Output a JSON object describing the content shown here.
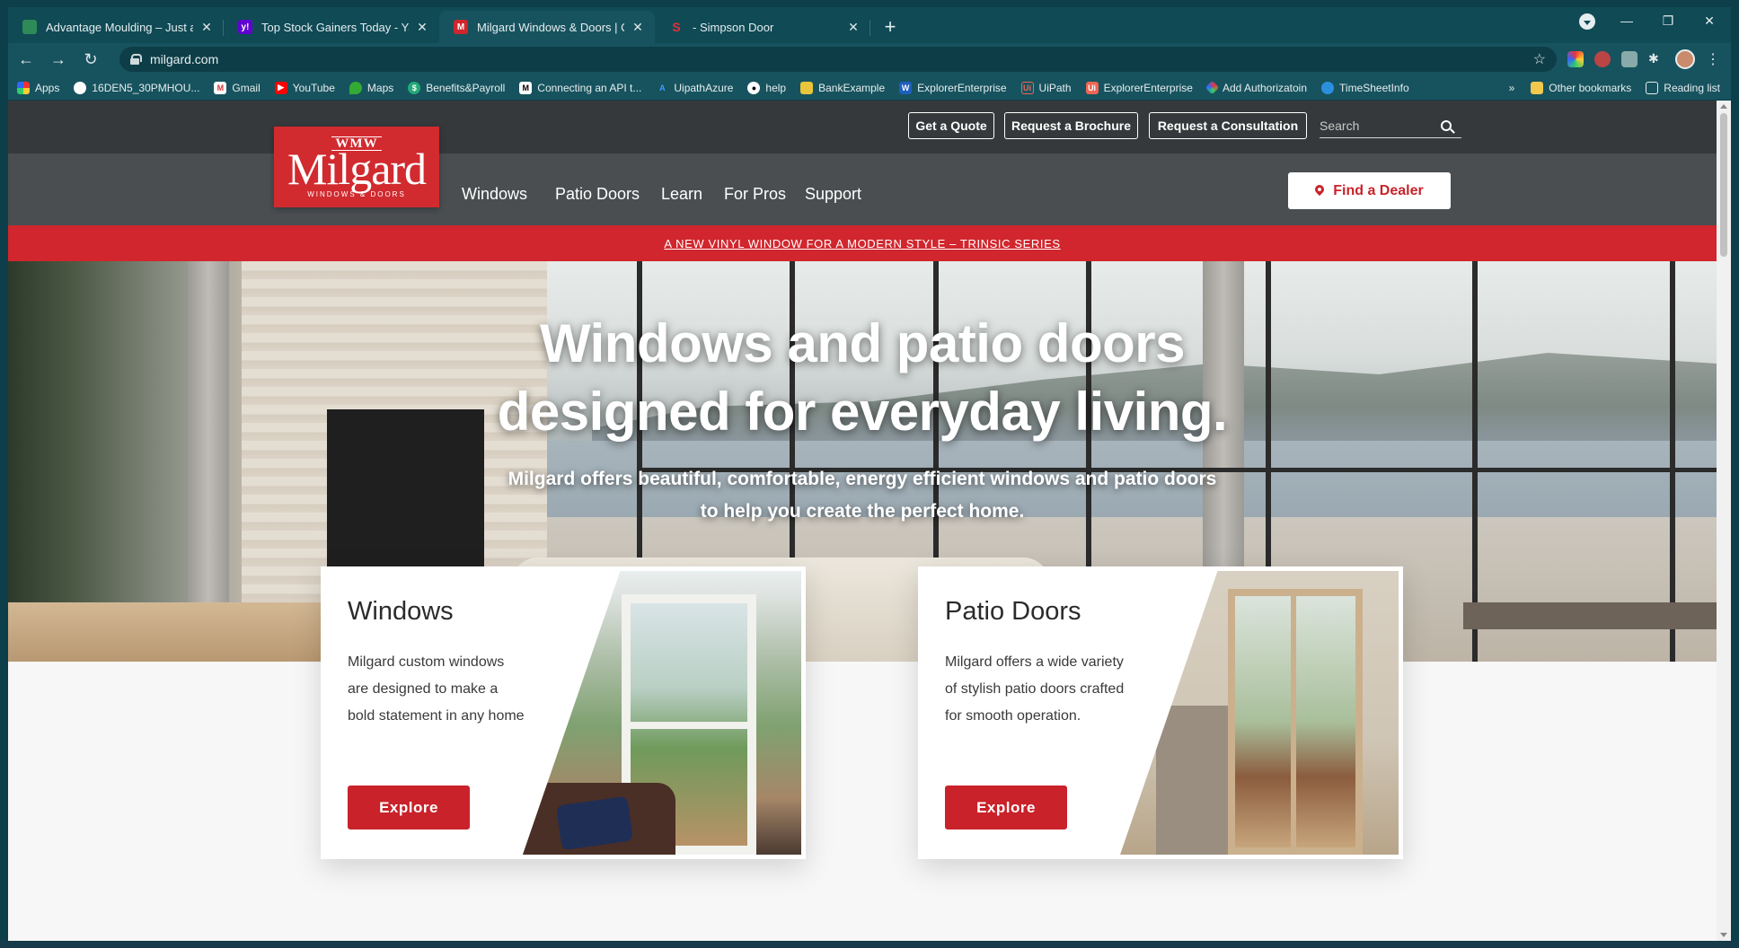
{
  "browser": {
    "tabs": [
      {
        "title": "Advantage Moulding – Just anoth",
        "active": false
      },
      {
        "title": "Top Stock Gainers Today - Yahoo",
        "active": false
      },
      {
        "title": "Milgard Windows & Doors | Cust",
        "active": true
      },
      {
        "title": "- Simpson Door",
        "active": false
      }
    ],
    "new_tab": "+",
    "url": "milgard.com",
    "bookmarks": [
      "Apps",
      "16DEN5_30PMHOU...",
      "Gmail",
      "YouTube",
      "Maps",
      "Benefits&Payroll",
      "Connecting an API t...",
      "UipathAzure",
      "help",
      "BankExample",
      "ExplorerEnterprise",
      "UiPath",
      "ExplorerEnterprise",
      "Add Authorizatoin",
      "TimeSheetInfo"
    ],
    "bookmarks_overflow": "»",
    "other_bookmarks": "Other bookmarks",
    "reading_list": "Reading list"
  },
  "site": {
    "utility": {
      "quote": "Get a Quote",
      "brochure": "Request a Brochure",
      "consultation": "Request a Consultation",
      "search_placeholder": "Search"
    },
    "logo": {
      "mark": "WMW",
      "word": "Milgard",
      "sub": "WINDOWS & DOORS"
    },
    "nav": [
      "Windows",
      "Patio Doors",
      "Learn",
      "For Pros",
      "Support"
    ],
    "dealer": "Find a Dealer",
    "promo": "A NEW VINYL WINDOW FOR A MODERN STYLE – TRINSIC SERIES",
    "hero": {
      "line1": "Windows and patio doors",
      "line2": "designed for everyday living.",
      "sub1": "Milgard offers beautiful, comfortable, energy efficient windows and patio doors",
      "sub2": "to help you create the perfect home."
    },
    "cards": [
      {
        "title": "Windows",
        "text": "Milgard custom windows are designed to make a bold statement in any home",
        "button": "Explore"
      },
      {
        "title": "Patio Doors",
        "text": "Milgard offers a wide variety of stylish patio doors crafted for smooth operation.",
        "button": "Explore"
      }
    ]
  },
  "colors": {
    "brand_red": "#d1262d",
    "utility_bar": "#36393b",
    "nav_bar": "#4a4e51",
    "chrome": "#0f4a55"
  }
}
